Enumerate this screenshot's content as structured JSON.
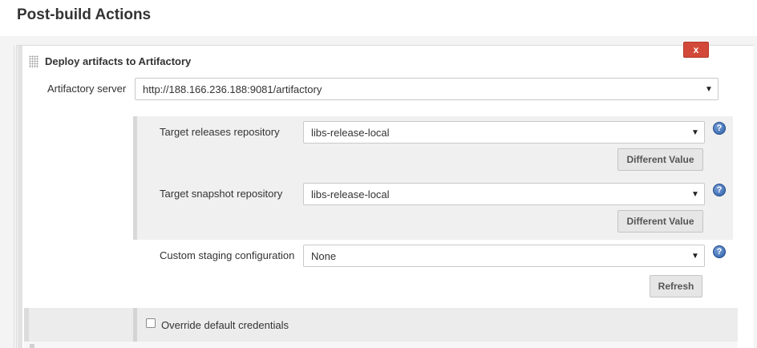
{
  "section": {
    "title": "Post-build Actions"
  },
  "deploy_block": {
    "title": "Deploy artifacts to Artifactory",
    "delete_label": "x",
    "artifactory_server": {
      "label": "Artifactory server",
      "value": "http://188.166.236.188:9081/artifactory"
    },
    "target_releases": {
      "label": "Target releases repository",
      "value": "libs-release-local",
      "different_value_label": "Different Value"
    },
    "target_snapshot": {
      "label": "Target snapshot repository",
      "value": "libs-release-local",
      "different_value_label": "Different Value"
    },
    "custom_staging": {
      "label": "Custom staging configuration",
      "value": "None",
      "refresh_label": "Refresh"
    },
    "override_credentials": {
      "label": "Override default credentials",
      "checked": false
    }
  },
  "icons": {
    "help": "?",
    "dropdown": "▼"
  },
  "colors": {
    "delete_button": "#d24939",
    "help_icon": "#2d5fa8",
    "panel_background": "#f0f0f0"
  }
}
